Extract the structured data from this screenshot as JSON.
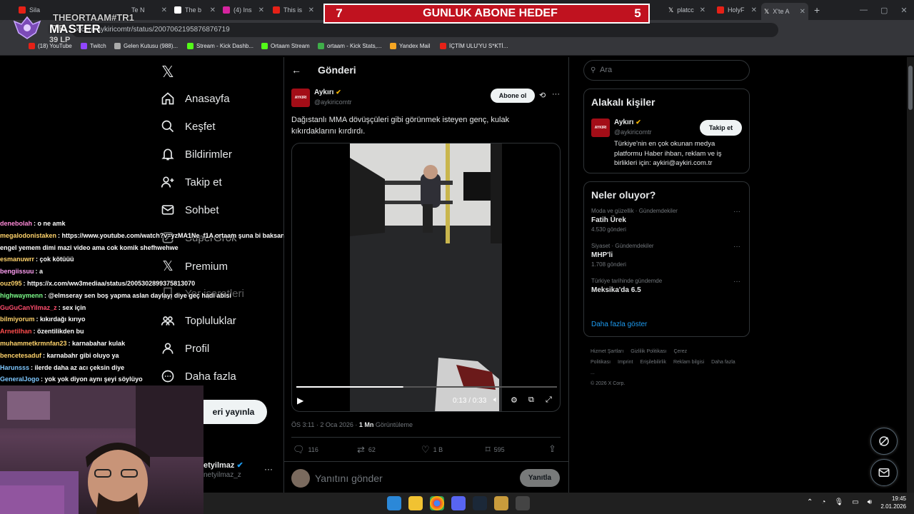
{
  "browser": {
    "tabs": [
      "Sila",
      "THEORTAAM#TR1 TR",
      "Te N",
      "The b",
      "(4) Ins",
      "This is",
      "platcc",
      "HolyF",
      "X'te A"
    ],
    "url": "x.com/aykiricomtr/status/2007062195876876719",
    "bookmarks": [
      "(18) YouTube",
      "Twitch",
      "Gelen Kutusu (988)...",
      "Stream - Kick Dashb...",
      "Ortaam Stream",
      "ortaam - Kick Stats,...",
      "Yandex Mail",
      "İÇTİM ULU'YU S*KTİ..."
    ]
  },
  "overlay": {
    "banner_left": "7",
    "banner_title": "GUNLUK ABONE HEDEF",
    "banner_right": "5",
    "rank_line1": "THEORTAAM#TR1 TR",
    "rank_line2": "MASTER",
    "rank_line3": "39 LP"
  },
  "nav": {
    "home": "Anasayfa",
    "explore": "Keşfet",
    "notifications": "Bildirimler",
    "follow": "Takip et",
    "chat": "Sohbet",
    "grok": "SuperGrok",
    "premium": "Premium",
    "lists": "Yer işaretleri",
    "communities": "Topluluklar",
    "profile": "Profil",
    "more": "Daha fazla",
    "post_button": "eri yayınla",
    "account_name": "etyilmaz",
    "account_handle": "netyilmaz_z"
  },
  "chat": [
    {
      "user": "denebolah",
      "msg": "o ne amk",
      "color": "#ff8ad8"
    },
    {
      "user": "megalodonistaken",
      "msg": "https://www.youtube.com/watch?v=yzMA1Ne_f1A ortaam şuna bi baksan engel yemem dimi mazi video ama cok komik shefhwehwe",
      "color": "#ffd36b"
    },
    {
      "user": "esmanuwrr",
      "msg": "çok kötüüü",
      "color": "#ffd36b"
    },
    {
      "user": "bengiissuu",
      "msg": "a",
      "color": "#ff9ff3"
    },
    {
      "user": "ouz095",
      "msg": "https://x.com/ww3mediaa/status/2005302899375813070",
      "color": "#ffd36b"
    },
    {
      "user": "highwaymenn",
      "msg": "@elmseray sen boş yapma aslan daylayı diye geç hadi abisi",
      "color": "#7cfc8a"
    },
    {
      "user": "GuGuCanYilmaz_z",
      "msg": "sex için",
      "color": "#ff4d6d"
    },
    {
      "user": "bilmiyorum",
      "msg": "kıkırdağı kırıyo",
      "color": "#ffd36b"
    },
    {
      "user": "Arnetilhan",
      "msg": "özentilikden bu",
      "color": "#ff4d4d"
    },
    {
      "user": "muhammetkrmnfan23",
      "msg": "karnabahar kulak",
      "color": "#ffd36b"
    },
    {
      "user": "bencetesaduf",
      "msg": "karnabahr gibi oluyo ya",
      "color": "#ffd36b"
    },
    {
      "user": "Harunsss",
      "msg": "ilerde daha az acı çeksin diye",
      "color": "#7ec8ff"
    },
    {
      "user": "GeneralJogo",
      "msg": "yok yok diyon aynı şeyi söylüyo",
      "color": "#7ec8ff"
    }
  ],
  "post": {
    "header_title": "Gönderi",
    "author_name": "Aykırı",
    "author_handle": "@aykiricomtr",
    "subscribe": "Abone ol",
    "text": "Dağıstanlı MMA dövüşçüleri gibi görünmek isteyen genç, kulak kıkırdaklarını kırdırdı.",
    "video_time": "0:13 / 0:33",
    "video_progress": 0.41,
    "meta_time": "ÖS 3:11 · 2 Oca 2026 · ",
    "meta_views": "1 Mn",
    "meta_views_label": "Görüntüleme",
    "replies": "116",
    "reposts": "62",
    "likes": "1 B",
    "bookmarks": "595",
    "reply_placeholder": "Yanıtını gönder",
    "reply_button": "Yanıtla"
  },
  "sidebar": {
    "search_placeholder": "Ara",
    "related_title": "Alakalı kişiler",
    "related_name": "Aykırı",
    "related_handle": "@aykiricomtr",
    "related_follow": "Takip et",
    "related_bio": "Türkiye'nin en çok okunan medya platformu Haber ihbarı, reklam ve iş birlikleri için: aykiri@aykiri.com.tr",
    "trends_title": "Neler oluyor?",
    "trends": [
      {
        "cat": "Moda ve güzellik · Gündemdekiler",
        "title": "Fatih Ürek",
        "count": "4.530 gönderi"
      },
      {
        "cat": "Siyaset · Gündemdekiler",
        "title": "MHP'li",
        "count": "1.708 gönderi"
      },
      {
        "cat": "Türkiye tarihinde gündemde",
        "title": "Meksika'da 6.5",
        "count": ""
      }
    ],
    "show_more": "Daha fazla göster",
    "footer_links": [
      "Hizmet Şartları",
      "Gizlilik Politikası",
      "Çerez Politikası",
      "Imprint",
      "Erişilebilirlik",
      "Reklam bilgisi",
      "Daha fazla ..."
    ],
    "copyright": "© 2026 X Corp."
  },
  "taskbar": {
    "time": "19:45",
    "date": "2.01.2026"
  },
  "colors": {
    "accent": "#1d9bf0",
    "banner": "#c0121f",
    "verified": "#f4b400"
  }
}
